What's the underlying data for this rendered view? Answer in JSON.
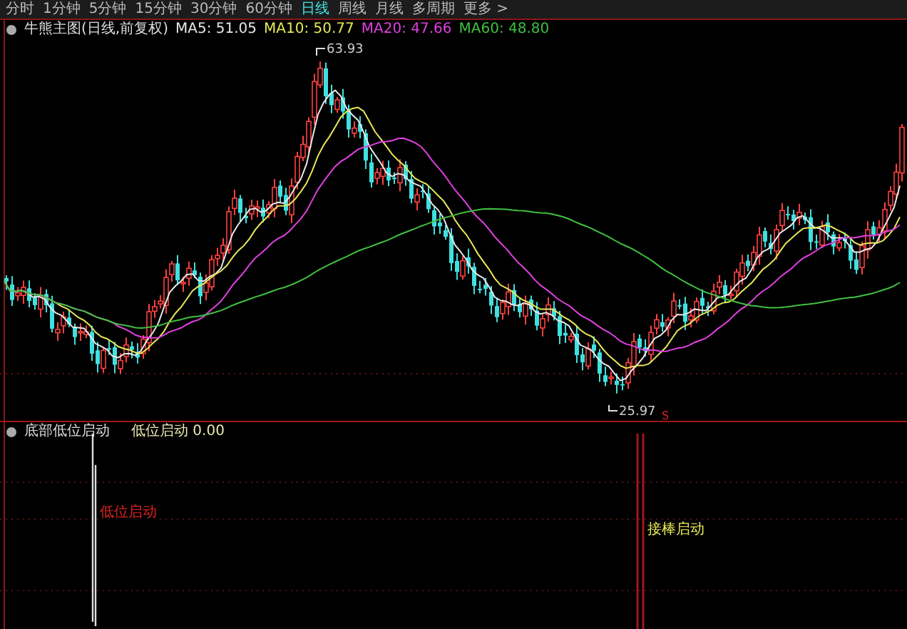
{
  "tabs": [
    {
      "label": "分时",
      "selected": false
    },
    {
      "label": "1分钟",
      "selected": false
    },
    {
      "label": "5分钟",
      "selected": false
    },
    {
      "label": "15分钟",
      "selected": false
    },
    {
      "label": "30分钟",
      "selected": false
    },
    {
      "label": "60分钟",
      "selected": false
    },
    {
      "label": "日线",
      "selected": true
    },
    {
      "label": "周线",
      "selected": false
    },
    {
      "label": "月线",
      "selected": false
    },
    {
      "label": "多周期",
      "selected": false
    },
    {
      "label": "更多 >",
      "selected": false
    }
  ],
  "main_panel": {
    "title": "牛熊主图(日线,前复权)",
    "averages": [
      {
        "label": "MA5: 51.05",
        "color": "#e8e8e8"
      },
      {
        "label": "MA10: 50.77",
        "color": "#e8e858"
      },
      {
        "label": "MA20: 47.66",
        "color": "#e040e0"
      },
      {
        "label": "MA60: 48.80",
        "color": "#40c040"
      }
    ],
    "high_label": "63.93",
    "low_label": "25.97",
    "signal_mark": "S"
  },
  "lower_panel": {
    "title": "底部低位启动",
    "reading": "低位启动 0.00",
    "annotations": [
      {
        "text": "低位启动",
        "color": "#e02020"
      },
      {
        "text": "接棒启动",
        "color": "#e8e858"
      }
    ]
  }
}
